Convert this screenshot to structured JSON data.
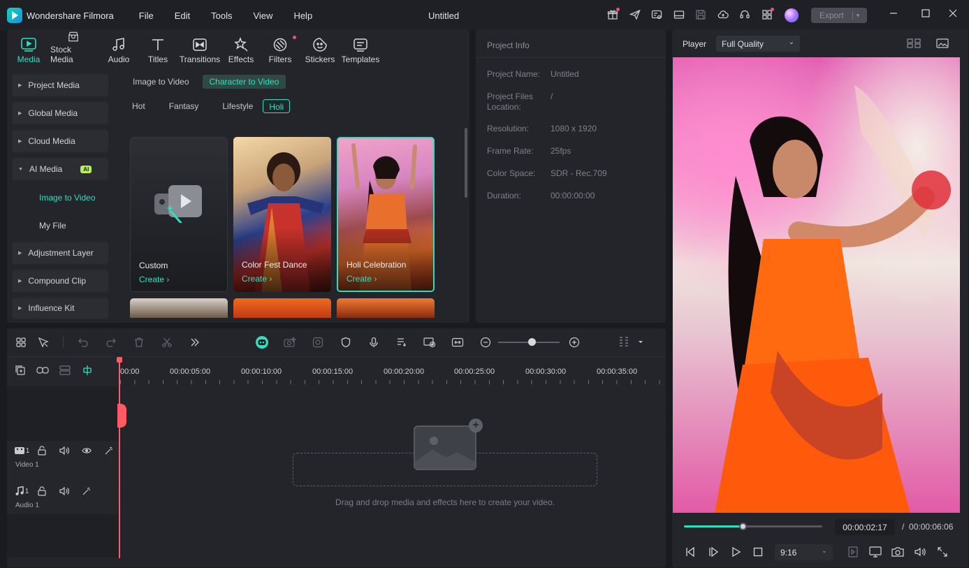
{
  "app": {
    "name": "Wondershare Filmora",
    "document_title": "Untitled",
    "menu": [
      "File",
      "Edit",
      "Tools",
      "View",
      "Help"
    ],
    "export_label": "Export"
  },
  "media_toolbar": [
    {
      "label": "Media",
      "icon": "media-icon",
      "active": true
    },
    {
      "label": "Stock Media",
      "icon": "stock-media-icon"
    },
    {
      "label": "Audio",
      "icon": "audio-icon"
    },
    {
      "label": "Titles",
      "icon": "titles-icon"
    },
    {
      "label": "Transitions",
      "icon": "transitions-icon"
    },
    {
      "label": "Effects",
      "icon": "effects-icon"
    },
    {
      "label": "Filters",
      "icon": "filters-icon",
      "badge": true
    },
    {
      "label": "Stickers",
      "icon": "stickers-icon"
    },
    {
      "label": "Templates",
      "icon": "templates-icon"
    }
  ],
  "sidebar": {
    "items": [
      {
        "label": "Project Media"
      },
      {
        "label": "Global Media"
      },
      {
        "label": "Cloud Media"
      },
      {
        "label": "AI Media",
        "badge": "AI",
        "expanded": true
      },
      {
        "label": "Adjustment Layer"
      },
      {
        "label": "Compound Clip"
      },
      {
        "label": "Influence Kit"
      }
    ],
    "sub_items": [
      {
        "label": "Image to Video",
        "active": true
      },
      {
        "label": "My File"
      }
    ]
  },
  "ai_media": {
    "tabs": [
      {
        "label": "Image to Video"
      },
      {
        "label": "Character to Video",
        "active": true
      }
    ],
    "categories": [
      {
        "label": "Hot"
      },
      {
        "label": "Fantasy"
      },
      {
        "label": "Lifestyle"
      },
      {
        "label": "Holi",
        "active": true
      }
    ],
    "cards": [
      {
        "title": "Custom",
        "action": "Create"
      },
      {
        "title": "Color Fest Dance",
        "action": "Create"
      },
      {
        "title": "Holi Celebration",
        "action": "Create",
        "selected": true
      }
    ]
  },
  "project_info": {
    "title": "Project Info",
    "fields": [
      {
        "label": "Project Name:",
        "value": "Untitled"
      },
      {
        "label": "Project Files Location:",
        "value": "/"
      },
      {
        "label": "Resolution:",
        "value": "1080 x 1920"
      },
      {
        "label": "Frame Rate:",
        "value": "25fps"
      },
      {
        "label": "Color Space:",
        "value": "SDR - Rec.709"
      },
      {
        "label": "Duration:",
        "value": "00:00:00:00"
      }
    ]
  },
  "player": {
    "label": "Player",
    "quality": "Full Quality",
    "current_time": "00:00:02:17",
    "time_separator": "/",
    "total_time": "00:00:06:06",
    "progress": 0.43,
    "aspect_ratio": "9:16"
  },
  "timeline": {
    "ruler": [
      "00:00",
      "00:00:05:00",
      "00:00:10:00",
      "00:00:15:00",
      "00:00:20:00",
      "00:00:25:00",
      "00:00:30:00",
      "00:00:35:00"
    ],
    "tracks": [
      {
        "name": "Video 1",
        "index": "1",
        "type": "video"
      },
      {
        "name": "Audio 1",
        "index": "1",
        "type": "audio"
      }
    ],
    "drop_hint": "Drag and drop media and effects here to create your video.",
    "zoom": 0.55
  },
  "colors": {
    "accent": "#2de0c0",
    "playhead": "#ff5a66",
    "background": "#1a1b1f",
    "panel": "#23252b"
  }
}
